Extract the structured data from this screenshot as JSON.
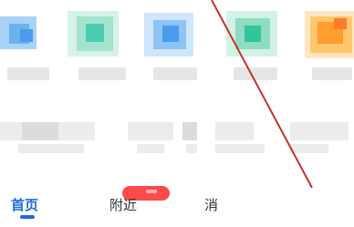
{
  "nav": {
    "home": "首页",
    "nearby": "附近",
    "messages": "消"
  },
  "colors": {
    "active": "#1f6bd9",
    "badge": "#ff4a4a",
    "annotation_line": "#c8322a"
  }
}
